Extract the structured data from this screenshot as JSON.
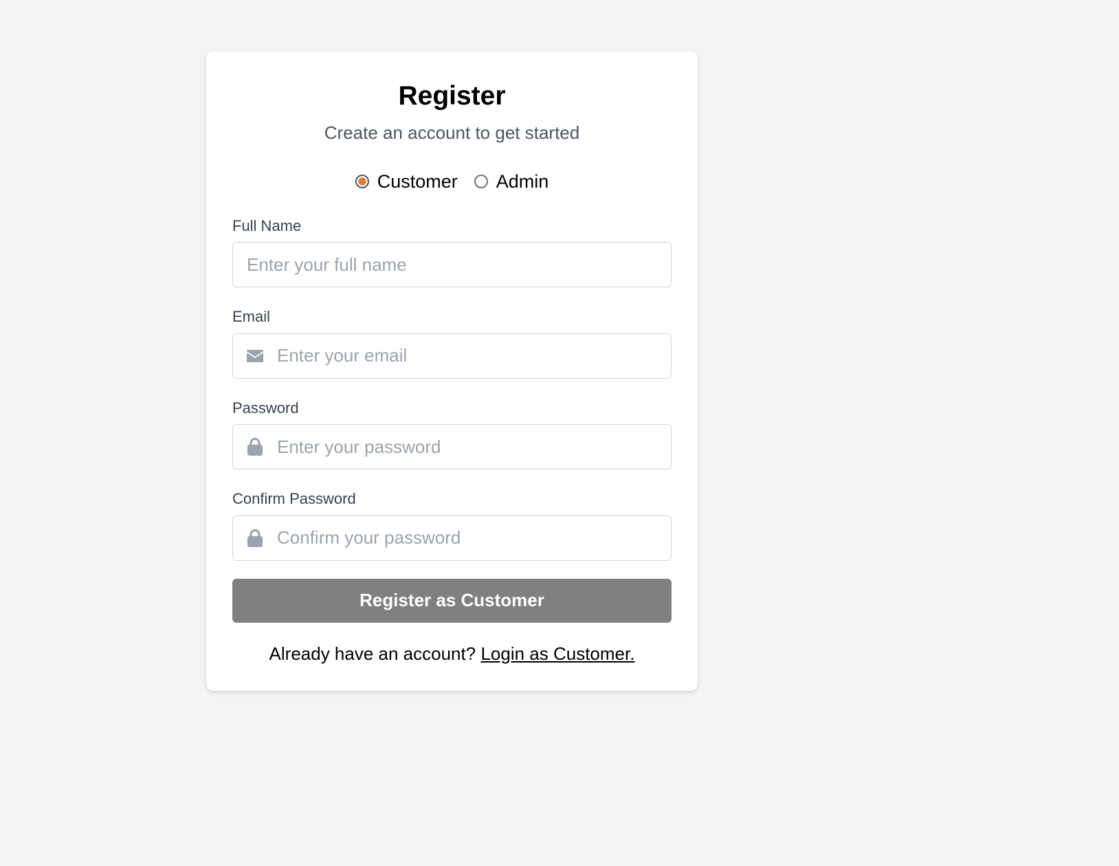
{
  "header": {
    "title": "Register",
    "subtitle": "Create an account to get started"
  },
  "roles": {
    "options": [
      {
        "label": "Customer",
        "checked": true
      },
      {
        "label": "Admin",
        "checked": false
      }
    ],
    "selected_color": "#e07b2e"
  },
  "form": {
    "full_name": {
      "label": "Full Name",
      "placeholder": "Enter your full name",
      "value": ""
    },
    "email": {
      "label": "Email",
      "placeholder": "Enter your email",
      "value": "",
      "icon": "envelope-icon"
    },
    "password": {
      "label": "Password",
      "placeholder": "Enter your password",
      "value": "",
      "icon": "lock-icon"
    },
    "confirm_password": {
      "label": "Confirm Password",
      "placeholder": "Confirm your password",
      "value": "",
      "icon": "lock-icon"
    },
    "submit_label": "Register as Customer",
    "submit_color": "#808080"
  },
  "footer": {
    "prompt": "Already have an account?",
    "link_label": "Login as Customer."
  }
}
